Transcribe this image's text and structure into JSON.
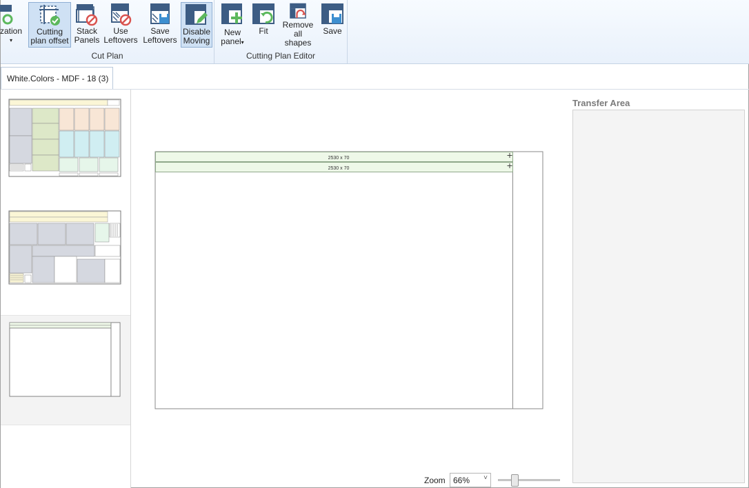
{
  "ribbon": {
    "groups": [
      {
        "caption": "Cut Plan",
        "buttons": [
          {
            "line1": "zation",
            "line2": "",
            "icon": "optimization-icon"
          },
          {
            "line1": "Cutting",
            "line2": "plan offset",
            "icon": "cutting-plan-offset-icon",
            "active": true
          },
          {
            "line1": "Stack",
            "line2": "Panels",
            "icon": "stack-panels-icon"
          },
          {
            "line1": "Use",
            "line2": "Leftovers",
            "icon": "use-leftovers-icon"
          },
          {
            "line1": "Save",
            "line2": "Leftovers",
            "icon": "save-leftovers-icon"
          },
          {
            "line1": "Disable",
            "line2": "Moving",
            "icon": "disable-moving-icon",
            "active": true
          }
        ]
      },
      {
        "caption": "Cutting Plan Editor",
        "buttons": [
          {
            "line1": "New",
            "line2": "panel",
            "icon": "new-panel-icon"
          },
          {
            "line1": "Fit",
            "line2": "",
            "icon": "fit-icon"
          },
          {
            "line1": "Remove",
            "line2": "all shapes",
            "icon": "remove-all-shapes-icon"
          },
          {
            "line1": "Save",
            "line2": "",
            "icon": "save-icon"
          }
        ]
      }
    ]
  },
  "tab": {
    "label": "White.Colors - MDF - 18 (3)"
  },
  "canvas": {
    "strips": [
      {
        "label": "2530 x 70"
      },
      {
        "label": "2530 x 70"
      }
    ]
  },
  "zoom": {
    "label": "Zoom",
    "value": "66%",
    "level": 0.25
  },
  "transfer": {
    "title": "Transfer Area"
  },
  "colors": {
    "ribbon_icon": "#3d5d84",
    "accent_green": "#5cb85c",
    "accent_red": "#d9534f",
    "strip_fill": "#eef8e8",
    "panel_gray": "#d5d8e0",
    "panel_yellow": "#fbf6d6",
    "panel_green": "#dde8c8",
    "panel_peach": "#f8e6d6",
    "panel_cyan": "#d0eef2",
    "panel_mint": "#e6f6ea"
  }
}
